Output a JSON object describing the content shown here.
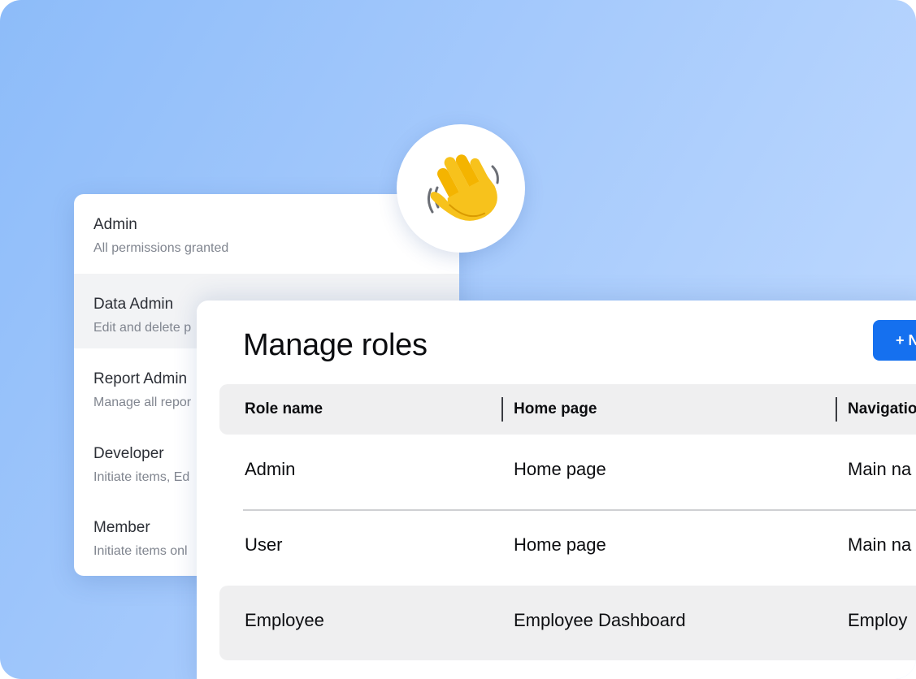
{
  "roles_list": {
    "items": [
      {
        "title": "Admin",
        "description": "All permissions granted"
      },
      {
        "title": "Data Admin",
        "description": "Edit and delete p"
      },
      {
        "title": "Report Admin",
        "description": "Manage all repor"
      },
      {
        "title": "Developer",
        "description": "Initiate items, Ed"
      },
      {
        "title": "Member",
        "description": "Initiate items onl"
      }
    ]
  },
  "wave": {
    "icon": "waving-hand-icon"
  },
  "manage": {
    "title": "Manage roles",
    "new_button_label": "+ N",
    "columns": [
      "Role name",
      "Home page",
      "Navigatio"
    ],
    "rows": [
      [
        "Admin",
        "Home page",
        "Main na"
      ],
      [
        "User",
        "Home page",
        "Main na"
      ],
      [
        "Employee",
        "Employee Dashboard",
        "Employ"
      ]
    ]
  },
  "colors": {
    "background_gradient_start": "#8dbcf9",
    "background_gradient_end": "#c3dcff",
    "primary_button": "#1570ef",
    "header_row": "#efeff0",
    "selected_item": "#f2f3f5"
  }
}
